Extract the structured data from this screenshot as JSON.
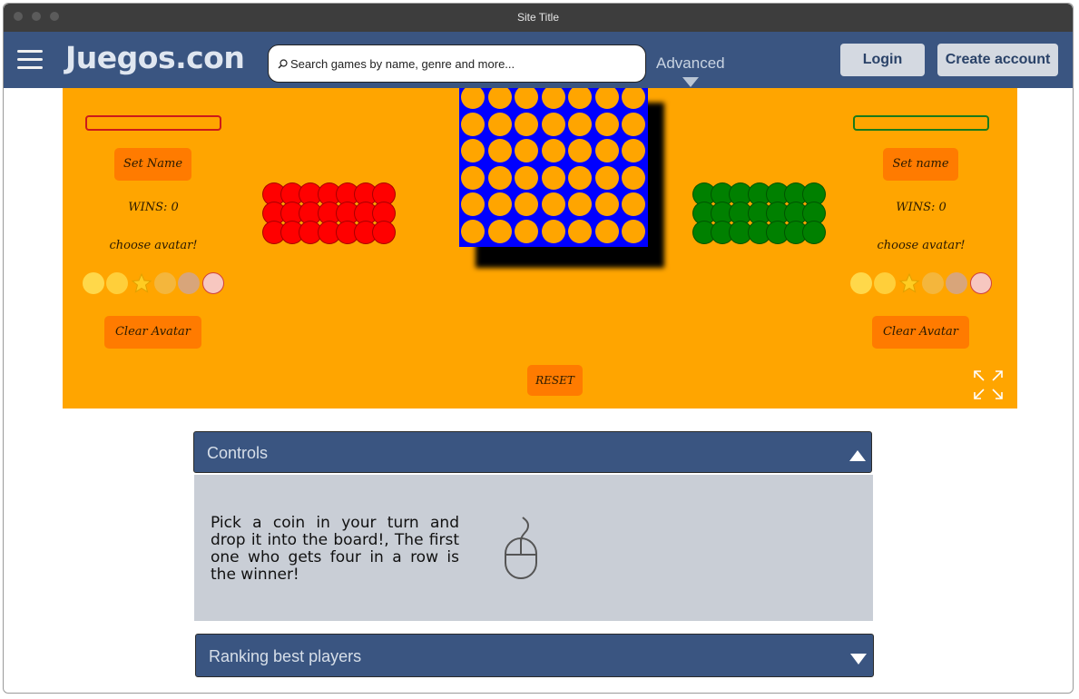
{
  "window": {
    "title": "Site Title"
  },
  "navbar": {
    "logo": "Juegos.con",
    "search_placeholder": "Search games by name, genre and more...",
    "advanced_label": "Advanced",
    "login_label": "Login",
    "create_account_label": "Create account"
  },
  "game": {
    "colors": {
      "background": "#ffa500",
      "board": "#0000ff",
      "player1": "#ff0000",
      "player2": "#008000",
      "button": "#ff7b00"
    },
    "player1": {
      "set_name_label": "Set Name",
      "wins_text": "WINS: 0",
      "choose_avatar_label": "choose avatar!",
      "clear_avatar_label": "Clear Avatar",
      "avatars": [
        "face-with-rolling-eyes",
        "woozy-face",
        "star",
        "thinking-face",
        "old-man-face",
        "pouting-face"
      ]
    },
    "player2": {
      "set_name_label": "Set name",
      "wins_text": "WINS: 0",
      "choose_avatar_label": "choose avatar!",
      "clear_avatar_label": "Clear Avatar",
      "avatars": [
        "face-with-rolling-eyes",
        "woozy-face",
        "star",
        "thinking-face",
        "old-man-face",
        "pouting-face"
      ]
    },
    "reset_label": "RESET",
    "board": {
      "columns": 7,
      "rows": 6
    },
    "coin_pile": {
      "columns": 7,
      "rows": 3
    },
    "fullscreen_icon": "expand-arrows-icon"
  },
  "controls": {
    "header": "Controls",
    "description": "Pick a coin in your turn and drop it into the board!, The first one who gets four in a row is the winner!",
    "icon": "mouse-icon"
  },
  "ranking": {
    "header": "Ranking best players"
  }
}
